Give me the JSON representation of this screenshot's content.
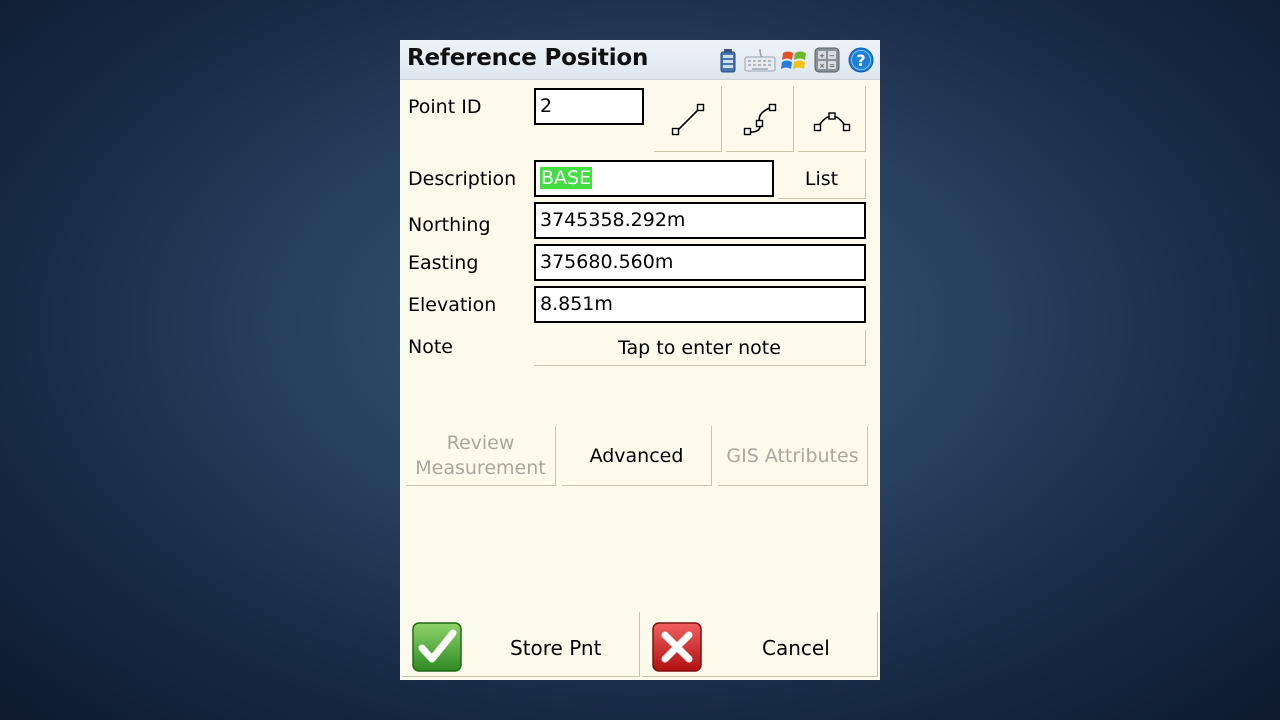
{
  "window": {
    "title": "Reference Position",
    "status_icons": [
      "battery-icon",
      "keyboard-icon",
      "windows-start-icon",
      "calculator-icon",
      "help-icon"
    ]
  },
  "form": {
    "point_id": {
      "label": "Point ID",
      "value": "2"
    },
    "description": {
      "label": "Description",
      "value": "BASE",
      "list_button": "List"
    },
    "northing": {
      "label": "Northing",
      "value": "3745358.292m"
    },
    "easting": {
      "label": "Easting",
      "value": "375680.560m"
    },
    "elevation": {
      "label": "Elevation",
      "value": "8.851m"
    },
    "note": {
      "label": "Note",
      "button": "Tap to enter note"
    }
  },
  "line_type_buttons": [
    "line-icon",
    "curve-icon",
    "arc-icon"
  ],
  "actions": {
    "review_line1": "Review",
    "review_line2": "Measurement",
    "advanced": "Advanced",
    "gis": "GIS Attributes"
  },
  "bottom": {
    "store": "Store Pnt",
    "cancel": "Cancel"
  },
  "colors": {
    "background_panel": "#fcfaea",
    "selection": "#44dd44",
    "store_green": "#4aa83a",
    "cancel_red": "#d42020"
  }
}
